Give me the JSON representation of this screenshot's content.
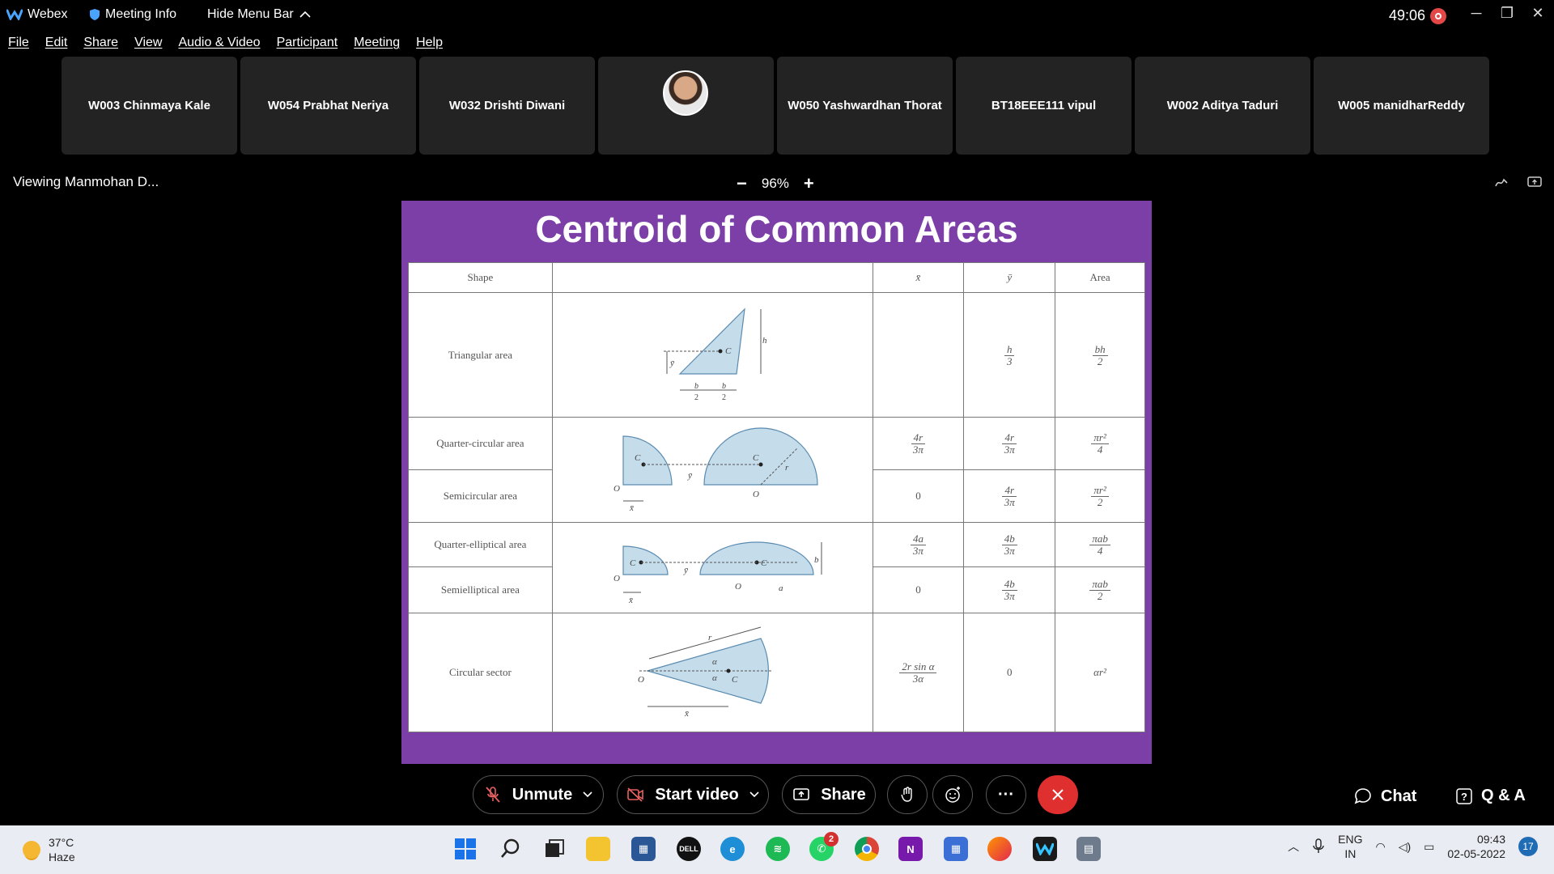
{
  "titlebar": {
    "app_name": "Webex",
    "meeting_info": "Meeting Info",
    "hide_menu": "Hide Menu Bar",
    "timer": "49:06"
  },
  "menu": [
    "File",
    "Edit",
    "Share",
    "View",
    "Audio & Video",
    "Participant",
    "Meeting",
    "Help"
  ],
  "participants": [
    {
      "name": "W003 Chinmaya Kale"
    },
    {
      "name": "W054 Prabhat Neriya"
    },
    {
      "name": "W032 Drishti Diwani"
    },
    {
      "name": ""
    },
    {
      "name": "W050 Yashwardhan Thorat"
    },
    {
      "name": "BT18EEE111 vipul"
    },
    {
      "name": "W002 Aditya Taduri"
    },
    {
      "name": "W005 manidharReddy"
    }
  ],
  "viewing": {
    "label": "Viewing Manmohan D...",
    "zoom": "96%",
    "minus": "−",
    "plus": "+"
  },
  "slide": {
    "title": "Centroid of Common Areas",
    "headers": [
      "Shape",
      "",
      "x̄",
      "ȳ",
      "Area"
    ],
    "rows": [
      {
        "shape": "Triangular area",
        "x": "",
        "y_num": "h",
        "y_den": "3",
        "area_num": "bh",
        "area_den": "2"
      },
      {
        "shape": "Quarter-circular area",
        "x_num": "4r",
        "x_den": "3π",
        "y_num": "4r",
        "y_den": "3π",
        "area_num": "πr²",
        "area_den": "4"
      },
      {
        "shape": "Semicircular area",
        "x": "0",
        "y_num": "4r",
        "y_den": "3π",
        "area_num": "πr²",
        "area_den": "2"
      },
      {
        "shape": "Quarter-elliptical area",
        "x_num": "4a",
        "x_den": "3π",
        "y_num": "4b",
        "y_den": "3π",
        "area_num": "πab",
        "area_den": "4"
      },
      {
        "shape": "Semielliptical area",
        "x": "0",
        "y_num": "4b",
        "y_den": "3π",
        "area_num": "πab",
        "area_den": "2"
      },
      {
        "shape": "Circular sector",
        "x_num": "2r sin α",
        "x_den": "3α",
        "y": "0",
        "area": "αr²"
      }
    ],
    "diagram_labels": {
      "tri_h": "h",
      "tri_c": "C",
      "tri_ybar": "ȳ",
      "tri_b": "b",
      "tri_two": "2",
      "circ_c": "C",
      "circ_o": "O",
      "circ_r": "r",
      "circ_xbar": "x̄",
      "circ_ybar": "ȳ",
      "ell_c": "C",
      "ell_o": "O",
      "ell_a": "a",
      "ell_b": "b",
      "ell_xbar": "x̄",
      "ell_ybar": "ȳ",
      "sec_r": "r",
      "sec_alpha": "α",
      "sec_c": "C",
      "sec_o": "O",
      "sec_xbar": "x̄"
    }
  },
  "controls": {
    "unmute": "Unmute",
    "start_video": "Start video",
    "share": "Share",
    "chat": "Chat",
    "qa": "Q & A",
    "more": "···"
  },
  "taskbar": {
    "temp": "37°C",
    "weather": "Haze",
    "whatsapp_badge": "2",
    "lang1": "ENG",
    "lang2": "IN",
    "time": "09:43",
    "date": "02-05-2022",
    "notifications": "17"
  },
  "colors": {
    "slide_bg": "#7b3fa7",
    "leave_red": "#e02f2f",
    "tile_bg": "#232323",
    "shape_fill": "#c5dcea"
  }
}
